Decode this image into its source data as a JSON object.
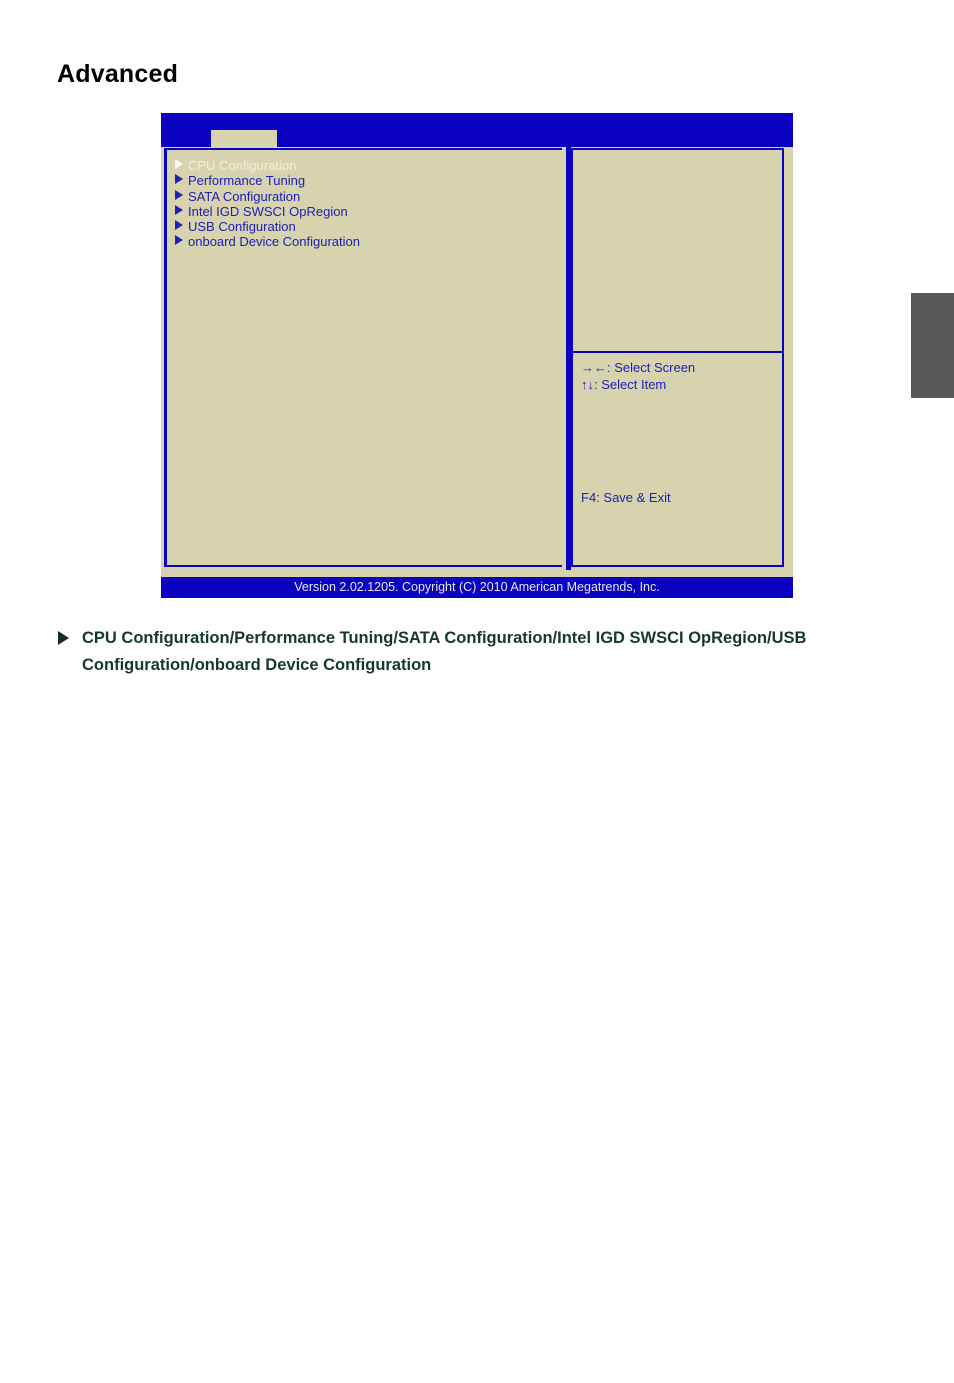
{
  "page": {
    "heading": "Advanced"
  },
  "bios": {
    "tab_label": "",
    "menu_items": [
      {
        "label": "CPU Configuration",
        "selected": true
      },
      {
        "label": "Performance Tuning",
        "selected": false
      },
      {
        "label": "SATA Configuration",
        "selected": false
      },
      {
        "label": "Intel IGD SWSCI OpRegion",
        "selected": false
      },
      {
        "label": "USB Configuration",
        "selected": false
      },
      {
        "label": "onboard Device Configuration",
        "selected": false
      }
    ],
    "help": {
      "select_screen": "→←: Select Screen",
      "select_item": "↑↓: Select Item",
      "save_exit": "F4: Save & Exit"
    },
    "footer": "Version 2.02.1205. Copyright (C) 2010 American Megatrends, Inc.",
    "colors": {
      "header_blue": "#0a02c0",
      "panel_beige": "#d6d3ae",
      "text_blue": "#2020b4",
      "selected_text": "#f2f0e0",
      "footer_text": "#e6e4e6"
    }
  },
  "caption": {
    "bullet": "►",
    "text": "CPU Configuration/Performance Tuning/SATA Configuration/Intel IGD SWSCI OpRegion/USB Configuration/onboard Device Configuration",
    "color": "#15392a"
  },
  "edge_marker": {
    "color": "#58585b"
  }
}
